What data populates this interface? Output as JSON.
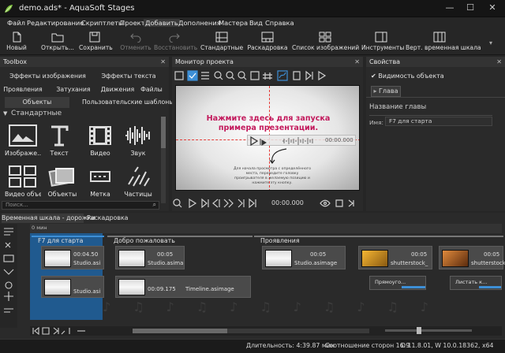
{
  "window": {
    "title": "demo.ads* - AquaSoft Stages",
    "minimize": "—",
    "maximize": "☐",
    "close": "✕"
  },
  "menu": [
    "Файл",
    "Редактирование",
    "Скриптлеты",
    "Проект",
    "Добавить",
    "Дополнения",
    "Мастера",
    "Вид",
    "Справка"
  ],
  "toolbar": {
    "new": "Новый",
    "open": "Открыть...",
    "save": "Сохранить",
    "undo": "Отменить",
    "redo": "Восстановить",
    "standard": "Стандартные",
    "storyboard": "Раскадровка",
    "imagelist": "Список изображений",
    "tools": "Инструменты",
    "vtimeline": "Верт. временная шкала"
  },
  "toolbox": {
    "title": "Toolbox",
    "tabs_row1": [
      "Эффекты изображения",
      "Эффекты текста"
    ],
    "tabs_row2": [
      "Проявления",
      "Затухания",
      "Движения",
      "Файлы"
    ],
    "tabs_row3": [
      "Объекты",
      "Пользовательские шаблоны"
    ],
    "section": "Стандартные",
    "objects": [
      "Изображе...",
      "Текст",
      "Видео",
      "Звук",
      "Видео объектов",
      "Объекты",
      "Метка",
      "Частицы"
    ],
    "search_placeholder": "Поиск..."
  },
  "monitor": {
    "title": "Монитор проекта",
    "overlay_line1": "Нажмите здесь для запуска",
    "overlay_line2": "примера презентации.",
    "player_time": "00:00.000",
    "hint": "Для начала просмотра с определённого места, переведите головку проигрывателя в желаемую позицию и нажмите эту кнопку.",
    "bottom_time": "00:00.000"
  },
  "properties": {
    "title": "Свойства",
    "checkbox_label": "Видимость объекта",
    "tab": "Глава",
    "section": "Название главы",
    "name_label": "Имя:",
    "name_value": "F7 для старта"
  },
  "timeline": {
    "tabs": [
      "Временная шкала - дорожки",
      "Раскадровка"
    ],
    "ruler_label": "0 мин",
    "chapters": [
      "F7 для старта",
      "Добро пожаловать",
      "Проявления"
    ],
    "clips": [
      {
        "time": "00:04.50",
        "name": "Studio.asi"
      },
      {
        "time": "00:05",
        "name": "Studio.asima"
      },
      {
        "time": "00:05",
        "name": "Studio.asimage"
      },
      {
        "time": "00:05",
        "name": "shutterstock_"
      },
      {
        "time": "00:05",
        "name": "shutterstock_"
      }
    ],
    "row2": [
      {
        "time": "",
        "name": "Studio.asi"
      },
      {
        "time": "00:09.175",
        "name": "Timeline.asimage"
      }
    ],
    "transitions": [
      "Прямоуго...",
      "Листать к..."
    ]
  },
  "status": {
    "duration": "Длительность: 4:39.87 мин",
    "aspect": "Соотношение сторон 16:9",
    "version": "D 11.8.01, W 10.0.18362, x64"
  },
  "colors": {
    "accent": "#3d8fd6",
    "overlay_text": "#c2185b",
    "bg": "#262626"
  }
}
